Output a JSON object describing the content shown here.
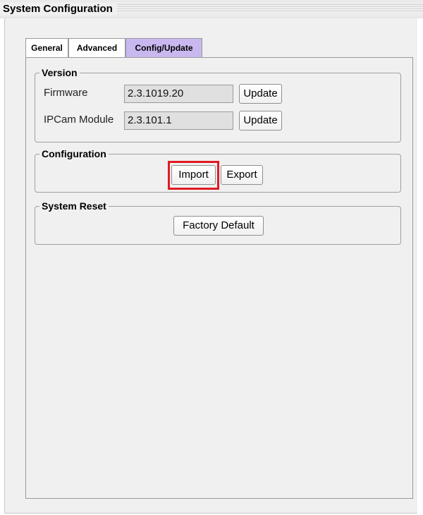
{
  "window": {
    "title": "System Configuration"
  },
  "tabs": [
    {
      "label": "General",
      "active": false
    },
    {
      "label": "Advanced",
      "active": false
    },
    {
      "label": "Config/Update",
      "active": true
    }
  ],
  "version": {
    "legend": "Version",
    "firmware": {
      "label": "Firmware",
      "value": "2.3.1019.20",
      "button": "Update"
    },
    "ipcam": {
      "label": "IPCam Module",
      "value": "2.3.101.1",
      "button": "Update"
    }
  },
  "configuration": {
    "legend": "Configuration",
    "import_label": "Import",
    "export_label": "Export"
  },
  "system_reset": {
    "legend": "System Reset",
    "factory_default_label": "Factory Default"
  },
  "colors": {
    "active_tab": "#c9b8f0",
    "highlight": "#e01b24"
  }
}
